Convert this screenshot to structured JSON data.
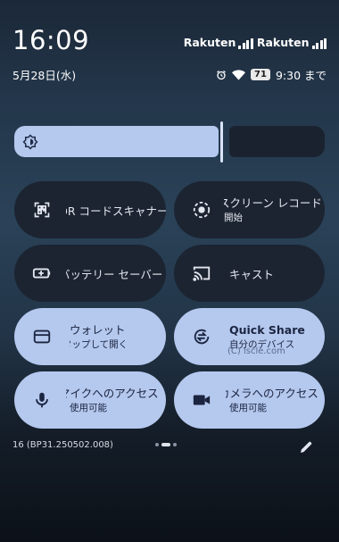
{
  "status_bar": {
    "time": "16:09",
    "carriers": [
      "Rakuten",
      "Rakuten"
    ],
    "date": "5月28日(水)",
    "battery_level": "71",
    "alarm_text": "9:30 まで",
    "icons": [
      "alarm-icon",
      "wifi-icon",
      "battery-icon"
    ]
  },
  "brightness": {
    "level_fraction": 0.66
  },
  "tiles": [
    {
      "line1": "QR コードスキャナー",
      "line2": "",
      "icon": "qr-scanner-icon",
      "active": false
    },
    {
      "line1": "スクリーン レコード",
      "line2": "開始",
      "icon": "screen-record-icon",
      "active": false
    },
    {
      "line1": "バッテリー セーバー",
      "line2": "",
      "icon": "battery-saver-icon",
      "active": false
    },
    {
      "line1": "キャスト",
      "line2": "",
      "icon": "cast-icon",
      "active": false
    },
    {
      "line1": "ウォレット",
      "line2": "タップして開く",
      "icon": "wallet-icon",
      "active": true
    },
    {
      "line1": "Quick Share",
      "line2": "自分のデバイス",
      "icon": "quick-share-icon",
      "active": true
    },
    {
      "line1": "マイクへのアクセス",
      "line2": "使用可能",
      "icon": "microphone-icon",
      "active": true
    },
    {
      "line1": "カメラへのアクセス",
      "line2": "使用可能",
      "icon": "camera-icon",
      "active": true
    }
  ],
  "watermark": "(C) iscle.com",
  "build_number": "16 (BP31.250502.008)",
  "page_indicator": {
    "pages": 3,
    "current": 2
  },
  "colors": {
    "tile_active": "#b5c8ee",
    "tile_inactive": "#1c2431",
    "accent": "#b5c8ee"
  }
}
